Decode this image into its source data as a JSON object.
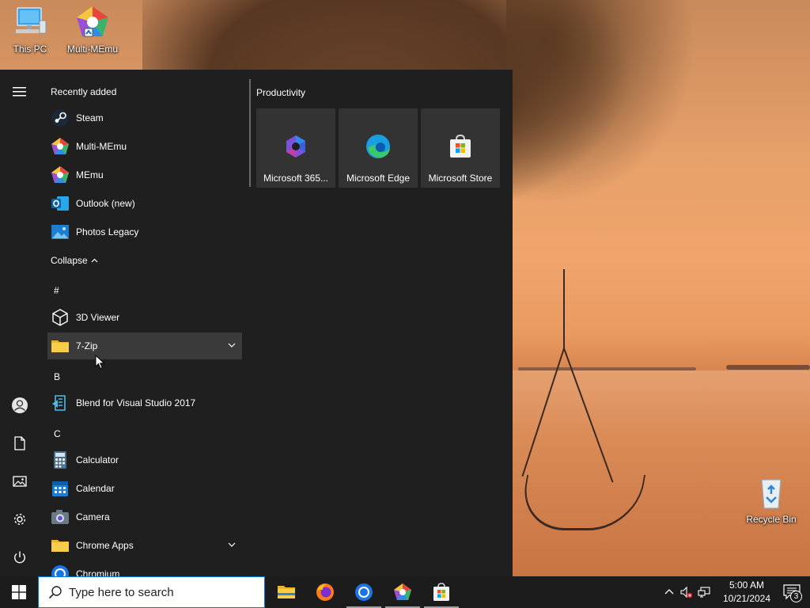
{
  "desktop": {
    "icons": [
      {
        "label": "This PC"
      },
      {
        "label": "Multi-MEmu"
      },
      {
        "label": "Recycle Bin"
      }
    ]
  },
  "start_menu": {
    "recently_added_label": "Recently added",
    "recent": [
      {
        "label": "Steam",
        "icon": "steam-icon"
      },
      {
        "label": "Multi-MEmu",
        "icon": "memu-icon"
      },
      {
        "label": "MEmu",
        "icon": "memu-icon"
      },
      {
        "label": "Outlook (new)",
        "icon": "outlook-icon"
      },
      {
        "label": "Photos Legacy",
        "icon": "photos-icon"
      }
    ],
    "collapse_label": "Collapse",
    "sections": [
      {
        "letter": "#",
        "apps": [
          {
            "label": "3D Viewer",
            "icon": "cube-icon",
            "expandable": false
          },
          {
            "label": "7-Zip",
            "icon": "folder-icon",
            "expandable": true,
            "hovered": true
          }
        ]
      },
      {
        "letter": "B",
        "apps": [
          {
            "label": "Blend for Visual Studio 2017",
            "icon": "blend-icon",
            "expandable": false
          }
        ]
      },
      {
        "letter": "C",
        "apps": [
          {
            "label": "Calculator",
            "icon": "calculator-icon",
            "expandable": false
          },
          {
            "label": "Calendar",
            "icon": "calendar-icon",
            "expandable": false
          },
          {
            "label": "Camera",
            "icon": "camera-icon",
            "expandable": false
          },
          {
            "label": "Chrome Apps",
            "icon": "folder-icon",
            "expandable": true
          },
          {
            "label": "Chromium",
            "icon": "chromium-icon",
            "expandable": false
          }
        ]
      }
    ],
    "group_title": "Productivity",
    "tiles": [
      {
        "label": "Microsoft 365...",
        "icon": "m365-icon"
      },
      {
        "label": "Microsoft Edge",
        "icon": "edge-icon"
      },
      {
        "label": "Microsoft Store",
        "icon": "store-icon"
      }
    ]
  },
  "taskbar": {
    "search_placeholder": "Type here to search",
    "pinned": [
      {
        "name": "file-explorer",
        "icon": "folder-icon"
      },
      {
        "name": "firefox",
        "icon": "firefox-icon"
      },
      {
        "name": "chromium",
        "icon": "chromium-icon"
      },
      {
        "name": "memu",
        "icon": "memu-icon"
      },
      {
        "name": "microsoft-store",
        "icon": "store-icon"
      }
    ],
    "time": "5:00 AM",
    "date": "10/21/2024",
    "notification_count": "3"
  },
  "colors": {
    "menu_bg": "#1f1f1f",
    "tile_bg": "#333333",
    "taskbar_bg": "#1c1c1c",
    "accent": "#0078d4"
  }
}
